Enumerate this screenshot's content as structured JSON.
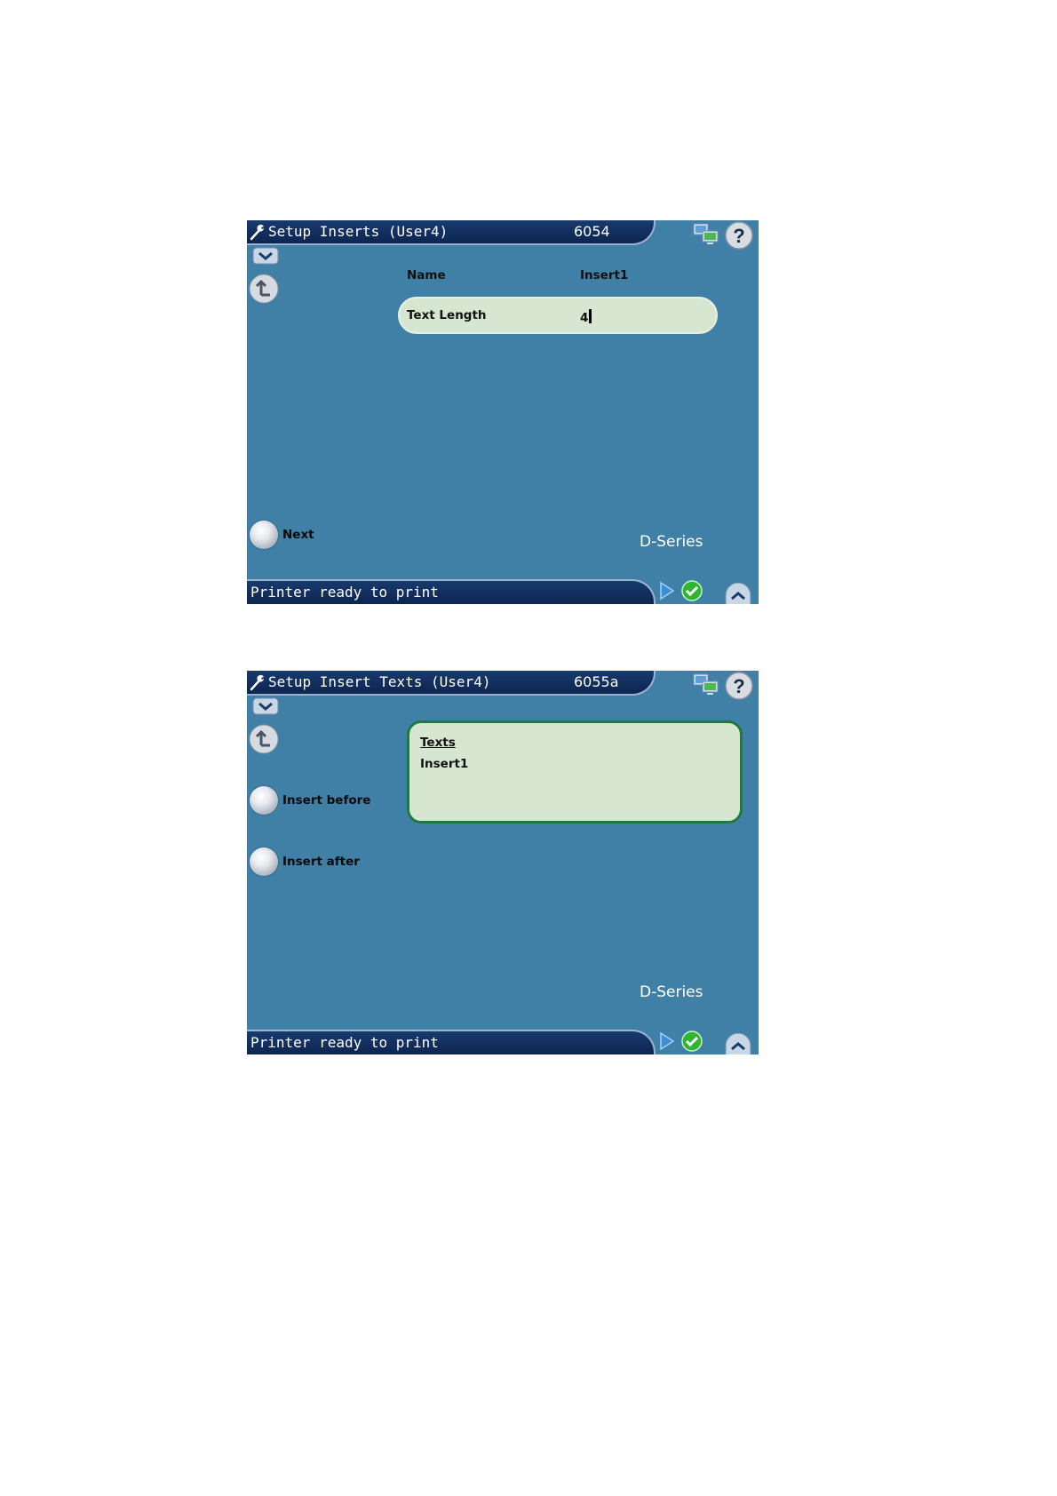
{
  "screens": [
    {
      "title": "Setup Inserts (User4)",
      "code": "6054",
      "fields": [
        {
          "label": "Name",
          "value": "Insert1"
        },
        {
          "label": "Text Length",
          "value": "4"
        }
      ],
      "buttons": [
        "Next"
      ],
      "brand": "D-Series",
      "status": "Printer ready to print"
    },
    {
      "title": "Setup Insert Texts (User4)",
      "code": "6055a",
      "list": {
        "header": "Texts",
        "items": [
          "Insert1"
        ]
      },
      "buttons": [
        "Insert before",
        "Insert after"
      ],
      "brand": "D-Series",
      "status": "Printer ready to print"
    }
  ],
  "icons": {
    "wrench": "wrench-icon",
    "network": "network-icon",
    "help": "help-icon",
    "down": "chevron-down-icon",
    "back": "back-arrow-icon",
    "play": "play-icon",
    "ok": "check-icon",
    "up": "chevron-up-icon"
  },
  "colors": {
    "screen_bg": "#4180a6",
    "bar_bg": "#0d2550",
    "field_bg": "#d6e6d0",
    "list_border": "#1e7a3e",
    "ok_green": "#2fb52f"
  }
}
